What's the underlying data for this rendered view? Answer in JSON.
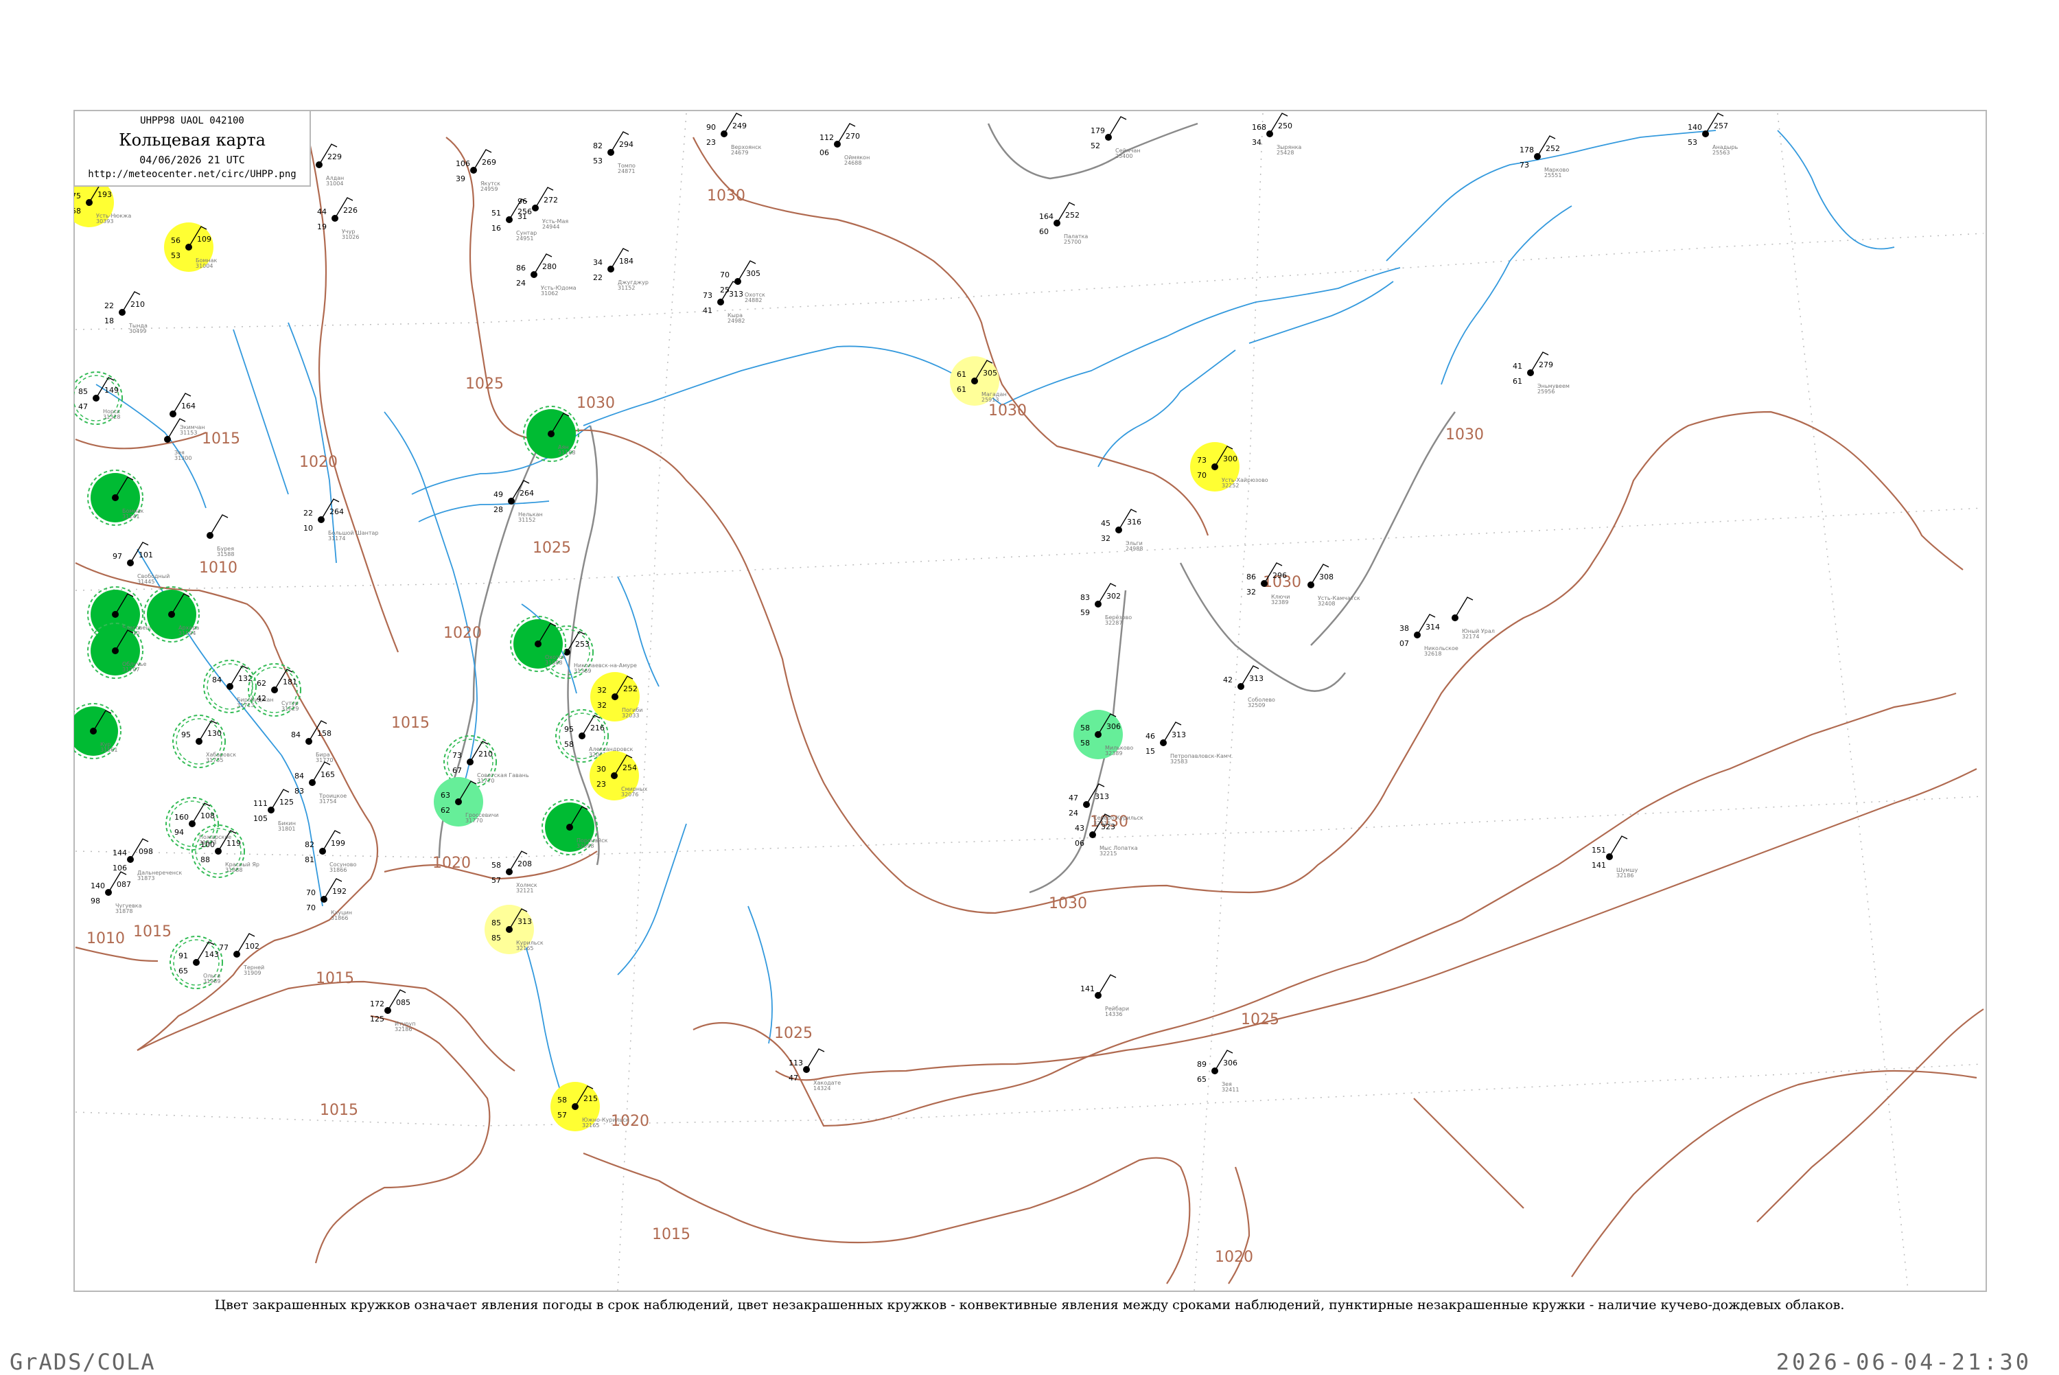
{
  "header": {
    "code": "UHPP98  UAOL  042100",
    "title": "Кольцевая карта",
    "date": "04/06/2026 21 UTC",
    "url": "http://meteocenter.net/circ/UHPP.png"
  },
  "caption": "Цвет закрашенных кружков означает явления погоды в срок наблюдений, цвет незакрашенных кружков - конвективные явления между сроками наблюдений, пунктирные незакрашенные кружки - наличие кучево-дождевых облаков.",
  "footer": {
    "left": "GrADS/COLA",
    "right": "2026-06-04-21:30"
  },
  "colors": {
    "isobar": "#b06a50",
    "water": "#3399dd",
    "coast": "#999999",
    "rain": "#00bb33",
    "shower": "#66ee99",
    "fog": "#ffff33",
    "haze": "#ffff99",
    "cb_ring": "#33bb55"
  },
  "isobar_labels": [
    "1030",
    "1025",
    "1030",
    "1020",
    "1015",
    "1010",
    "1025",
    "1020",
    "1015",
    "1030",
    "1030",
    "1030",
    "1030",
    "1025",
    "1020",
    "1015",
    "1025",
    "1015",
    "1020",
    "1015",
    "1020",
    "1030",
    "1010",
    "1015"
  ],
  "stations": [
    {
      "name": "Усть-Нюкжа",
      "id": "30393",
      "p": "193",
      "t": "75",
      "td": "58",
      "wx": "fog"
    },
    {
      "name": "Бомнак",
      "id": "31004",
      "p": "109",
      "t": "56",
      "td": "53",
      "wx": "fog"
    },
    {
      "name": "Тында",
      "id": "30499",
      "p": "210",
      "t": "22",
      "td": "18",
      "wx": ""
    },
    {
      "name": "Экимчан",
      "id": "31153",
      "p": "164",
      "t": "",
      "td": "",
      "wx": ""
    },
    {
      "name": "Зея",
      "id": "31300",
      "p": "",
      "t": "",
      "td": "",
      "wx": ""
    },
    {
      "name": "Норск",
      "id": "31328",
      "p": "149",
      "t": "85",
      "td": "47",
      "wx": "cb"
    },
    {
      "name": "Свободный",
      "id": "31445",
      "p": "101",
      "t": "97",
      "td": "",
      "wx": ""
    },
    {
      "name": "Бурея",
      "id": "31588",
      "p": "",
      "t": "",
      "td": "",
      "wx": ""
    },
    {
      "name": "Бомнак",
      "id": "31241",
      "p": "",
      "t": "",
      "td": "",
      "wx": "rain"
    },
    {
      "name": "Благовещенск",
      "id": "31510",
      "p": "",
      "t": "",
      "td": "",
      "wx": "rain"
    },
    {
      "name": "Архара",
      "id": "31594",
      "p": "",
      "t": "",
      "td": "",
      "wx": "rain"
    },
    {
      "name": "Облучье",
      "id": "31707",
      "p": "",
      "t": "",
      "td": "",
      "wx": "rain"
    },
    {
      "name": "Биробиджан",
      "id": "31713",
      "p": "132",
      "t": "84",
      "td": "",
      "wx": "cb"
    },
    {
      "name": "Сутур",
      "id": "31629",
      "p": "181",
      "t": "62",
      "td": "42",
      "wx": "cb"
    },
    {
      "name": "Хабаровск",
      "id": "31735",
      "p": "130",
      "t": "95",
      "td": "",
      "wx": "cb"
    },
    {
      "name": "Кур",
      "id": "31561",
      "p": "",
      "t": "",
      "td": "",
      "wx": "rain"
    },
    {
      "name": "Бира",
      "id": "31770",
      "p": "158",
      "t": "84",
      "td": "",
      "wx": ""
    },
    {
      "name": "Троицкое",
      "id": "31754",
      "p": "165",
      "t": "84",
      "td": "83",
      "wx": ""
    },
    {
      "name": "Бикин",
      "id": "31801",
      "p": "125",
      "t": "111",
      "td": "105",
      "wx": ""
    },
    {
      "name": "Дальнереченск",
      "id": "31873",
      "p": "098",
      "t": "144",
      "td": "106",
      "wx": ""
    },
    {
      "name": "Пожарское",
      "id": "31873",
      "p": "108",
      "t": "160",
      "td": "94",
      "wx": "cb"
    },
    {
      "name": "Красный Яр",
      "id": "31888",
      "p": "119",
      "t": "100",
      "td": "88",
      "wx": "cb"
    },
    {
      "name": "Чугуевка",
      "id": "31878",
      "p": "087",
      "t": "140",
      "td": "98",
      "wx": ""
    },
    {
      "name": "Ольга",
      "id": "31989",
      "p": "143",
      "t": "91",
      "td": "65",
      "wx": "cb"
    },
    {
      "name": "Терней",
      "id": "31909",
      "p": "102",
      "t": "77",
      "td": "",
      "wx": ""
    },
    {
      "name": "Кхуцин",
      "id": "31866",
      "p": "192",
      "t": "70",
      "td": "70",
      "wx": ""
    },
    {
      "name": "Сосуново",
      "id": "31866",
      "p": "199",
      "t": "82",
      "td": "81",
      "wx": ""
    },
    {
      "name": "Советская Гавань",
      "id": "31770",
      "p": "210",
      "t": "73",
      "td": "67",
      "wx": "cb"
    },
    {
      "name": "Гроссевичи",
      "id": "31770",
      "p": "",
      "t": "63",
      "td": "62",
      "wx": "shower"
    },
    {
      "name": "Александровск",
      "id": "32061",
      "p": "216",
      "t": "95",
      "td": "58",
      "wx": "cb"
    },
    {
      "name": "Поронайск",
      "id": "32098",
      "p": "",
      "t": "",
      "td": "",
      "wx": "rain"
    },
    {
      "name": "Смирных",
      "id": "32076",
      "p": "254",
      "t": "30",
      "td": "23",
      "wx": "fog"
    },
    {
      "name": "Погиби",
      "id": "32033",
      "p": "252",
      "t": "32",
      "td": "32",
      "wx": "fog"
    },
    {
      "name": "Николаевск-на-Амуре",
      "id": "31369",
      "p": "253",
      "t": "",
      "td": "",
      "wx": "cb"
    },
    {
      "name": "Охотск",
      "id": "31088",
      "p": "",
      "t": "",
      "td": "",
      "wx": "rain"
    },
    {
      "name": "Аян",
      "id": "31168",
      "p": "",
      "t": "",
      "td": "",
      "wx": "rain"
    },
    {
      "name": "Южно-Курильск",
      "id": "32165",
      "p": "215",
      "t": "58",
      "td": "57",
      "wx": "fog"
    },
    {
      "name": "Курильск",
      "id": "32165",
      "p": "313",
      "t": "85",
      "td": "85",
      "wx": "haze"
    },
    {
      "name": "Холмск",
      "id": "32121",
      "p": "208",
      "t": "58",
      "td": "57",
      "wx": ""
    },
    {
      "name": "Магадан",
      "id": "25913",
      "p": "305",
      "t": "61",
      "td": "61",
      "wx": "haze"
    },
    {
      "name": "Усть-Хайрюзово",
      "id": "32252",
      "p": "300",
      "t": "73",
      "td": "70",
      "wx": "fog"
    },
    {
      "name": "Мильково",
      "id": "32389",
      "p": "306",
      "t": "58",
      "td": "58",
      "wx": "shower"
    },
    {
      "name": "Ключи",
      "id": "32389",
      "p": "296",
      "t": "86",
      "td": "32",
      "wx": ""
    },
    {
      "name": "Усть-Камчатск",
      "id": "32408",
      "p": "308",
      "t": "",
      "td": "",
      "wx": ""
    },
    {
      "name": "Никольское",
      "id": "32618",
      "p": "314",
      "t": "38",
      "td": "07",
      "wx": ""
    },
    {
      "name": "Соболево",
      "id": "32509",
      "p": "313",
      "t": "42",
      "td": "",
      "wx": ""
    },
    {
      "name": "Петропавловск-Камч.",
      "id": "32583",
      "p": "313",
      "t": "46",
      "td": "15",
      "wx": ""
    },
    {
      "name": "Мыс Лопатка",
      "id": "32215",
      "p": "323",
      "t": "43",
      "td": "06",
      "wx": ""
    },
    {
      "name": "Северо-Курильск",
      "id": "32215",
      "p": "313",
      "t": "47",
      "td": "24",
      "wx": ""
    },
    {
      "name": "Палатка",
      "id": "25700",
      "p": "252",
      "t": "164",
      "td": "60",
      "wx": ""
    },
    {
      "name": "Сеймчан",
      "id": "25400",
      "p": "",
      "t": "179",
      "td": "52",
      "wx": ""
    },
    {
      "name": "Зырянка",
      "id": "25428",
      "p": "250",
      "t": "168",
      "td": "34",
      "wx": ""
    },
    {
      "name": "Марково",
      "id": "25551",
      "p": "252",
      "t": "178",
      "td": "73",
      "wx": ""
    },
    {
      "name": "Анадырь",
      "id": "25563",
      "p": "257",
      "t": "140",
      "td": "53",
      "wx": ""
    },
    {
      "name": "Эньмувеем",
      "id": "25956",
      "p": "279",
      "t": "41",
      "td": "61",
      "wx": ""
    },
    {
      "name": "Оймякон",
      "id": "24688",
      "p": "270",
      "t": "112",
      "td": "06",
      "wx": ""
    },
    {
      "name": "Верхоянск",
      "id": "24679",
      "p": "249",
      "t": "90",
      "td": "23",
      "wx": ""
    },
    {
      "name": "Томпо",
      "id": "24871",
      "p": "294",
      "t": "82",
      "td": "53",
      "wx": ""
    },
    {
      "name": "Усть-Мая",
      "id": "24944",
      "p": "272",
      "t": "96",
      "td": "31",
      "wx": ""
    },
    {
      "name": "Алдан",
      "id": "31004",
      "p": "229",
      "t": "70",
      "td": "34",
      "wx": ""
    },
    {
      "name": "Якутск",
      "id": "24959",
      "p": "269",
      "t": "106",
      "td": "39",
      "wx": ""
    },
    {
      "name": "Учур",
      "id": "31026",
      "p": "226",
      "t": "44",
      "td": "19",
      "wx": ""
    },
    {
      "name": "Сунтар",
      "id": "24951",
      "p": "256",
      "t": "51",
      "td": "16",
      "wx": ""
    },
    {
      "name": "Усть-Юдома",
      "id": "31062",
      "p": "280",
      "t": "86",
      "td": "24",
      "wx": ""
    },
    {
      "name": "Нелькан",
      "id": "31152",
      "p": "264",
      "t": "49",
      "td": "28",
      "wx": ""
    },
    {
      "name": "Большой Шантар",
      "id": "31174",
      "p": "264",
      "t": "22",
      "td": "10",
      "wx": ""
    },
    {
      "name": "Джугджур",
      "id": "31152",
      "p": "184",
      "t": "34",
      "td": "22",
      "wx": ""
    },
    {
      "name": "Охотск",
      "id": "24882",
      "p": "305",
      "t": "70",
      "td": "25",
      "wx": ""
    },
    {
      "name": "Кыра",
      "id": "24982",
      "p": "313",
      "t": "73",
      "td": "41",
      "wx": ""
    },
    {
      "name": "Эльги",
      "id": "24988",
      "p": "316",
      "t": "45",
      "td": "32",
      "wx": ""
    },
    {
      "name": "Берёзово",
      "id": "32287",
      "p": "302",
      "t": "83",
      "td": "59",
      "wx": ""
    },
    {
      "name": "Зея",
      "id": "32411",
      "p": "306",
      "t": "89",
      "td": "65",
      "wx": ""
    },
    {
      "name": "Шумшу",
      "id": "32186",
      "p": "",
      "t": "151",
      "td": "141",
      "wx": ""
    },
    {
      "name": "Итуруп",
      "id": "32186",
      "p": "085",
      "t": "172",
      "td": "125",
      "wx": ""
    },
    {
      "name": "Хакодате",
      "id": "14324",
      "p": "",
      "t": "113",
      "td": "47",
      "wx": ""
    },
    {
      "name": "Рейбари",
      "id": "14336",
      "p": "",
      "t": "141",
      "td": "",
      "wx": ""
    },
    {
      "name": "Юный Урал",
      "id": "32174",
      "p": "",
      "t": "",
      "td": "",
      "wx": ""
    }
  ]
}
